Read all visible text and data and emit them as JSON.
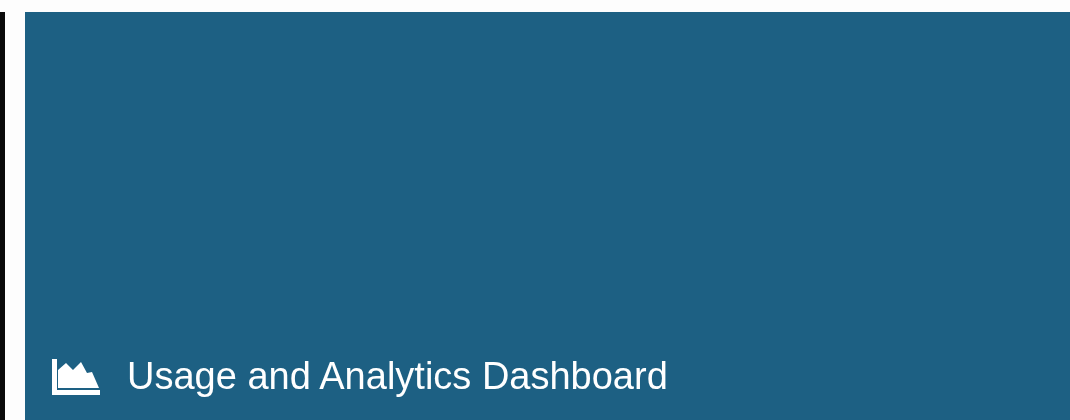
{
  "panel": {
    "title": "Usage and Analytics Dashboard"
  }
}
